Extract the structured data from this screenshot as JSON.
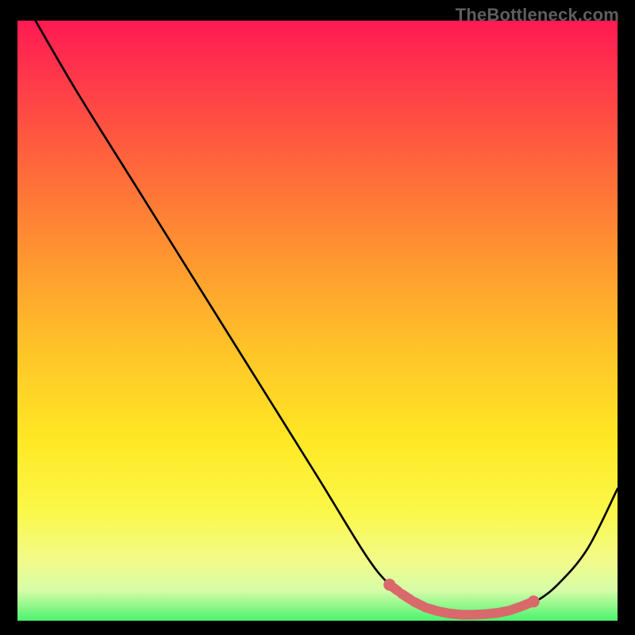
{
  "watermark": "TheBottleneck.com",
  "chart_data": {
    "type": "line",
    "title": "",
    "xlabel": "",
    "ylabel": "",
    "xlim": [
      0,
      100
    ],
    "ylim": [
      0,
      100
    ],
    "series": [
      {
        "name": "curve",
        "x": [
          3,
          10,
          20,
          30,
          40,
          50,
          58,
          62,
          66,
          70,
          74,
          78,
          82,
          86,
          90,
          95,
          100
        ],
        "y": [
          100,
          88,
          72,
          56,
          40,
          24,
          11,
          6,
          3,
          1.5,
          1,
          1,
          1.5,
          3,
          6,
          12,
          22
        ]
      }
    ],
    "markers": {
      "name": "dotted-segment",
      "color": "#d9696b",
      "points_x": [
        62,
        64,
        66,
        68,
        70,
        72,
        74,
        76,
        78,
        80,
        82,
        84,
        86
      ],
      "points_y": [
        6.0,
        4.5,
        3.2,
        2.2,
        1.6,
        1.2,
        1.0,
        1.0,
        1.1,
        1.3,
        1.7,
        2.4,
        3.2
      ]
    },
    "background_gradient": {
      "stops": [
        {
          "pos": 0,
          "color": "#ff1a52"
        },
        {
          "pos": 25,
          "color": "#ff6a3a"
        },
        {
          "pos": 55,
          "color": "#ffc428"
        },
        {
          "pos": 82,
          "color": "#fbf84a"
        },
        {
          "pos": 100,
          "color": "#4bf36e"
        }
      ]
    }
  }
}
